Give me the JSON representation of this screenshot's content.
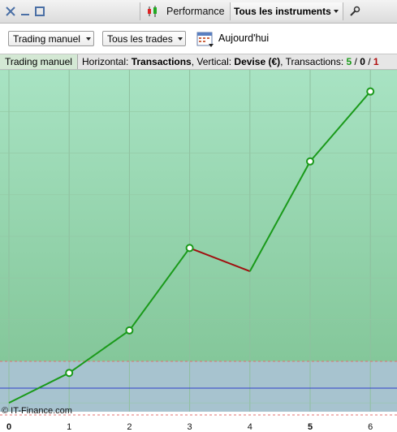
{
  "titlebar": {
    "performance_label": "Performance",
    "instruments_label": "Tous les instruments"
  },
  "toolbar": {
    "mode_select": "Trading manuel",
    "trades_select": "Tous les trades",
    "date_label": "Aujourd'hui"
  },
  "infobar": {
    "mode_tab": "Trading manuel",
    "horizontal_prefix": "Horizontal: ",
    "horizontal_value": "Transactions",
    "vertical_prefix": ", Vertical: ",
    "vertical_value": "Devise (€)",
    "transactions_prefix": ", Transactions: ",
    "wins": "5",
    "sep1": " / ",
    "neutral": "0",
    "sep2": " / ",
    "losses": "1"
  },
  "copyright": "© IT-Finance.com",
  "colors": {
    "win_line": "#1a9a1a",
    "loss_line": "#a01010",
    "positive_zone": "#9fd9b5",
    "negative_zone": "#a7c3cf",
    "zero_line": "#2f3fc8"
  },
  "chart_data": {
    "type": "line",
    "x": [
      0,
      1,
      2,
      3,
      4,
      5,
      6
    ],
    "xticks": [
      "0",
      "1",
      "2",
      "3",
      "4",
      "5",
      "6"
    ],
    "bold_ticks": [
      "0",
      "5"
    ],
    "y": [
      0,
      36,
      87,
      186,
      158,
      290,
      374
    ],
    "ylim": [
      -35,
      400
    ],
    "loss_segments": [
      [
        3,
        4
      ]
    ],
    "grid": true
  }
}
